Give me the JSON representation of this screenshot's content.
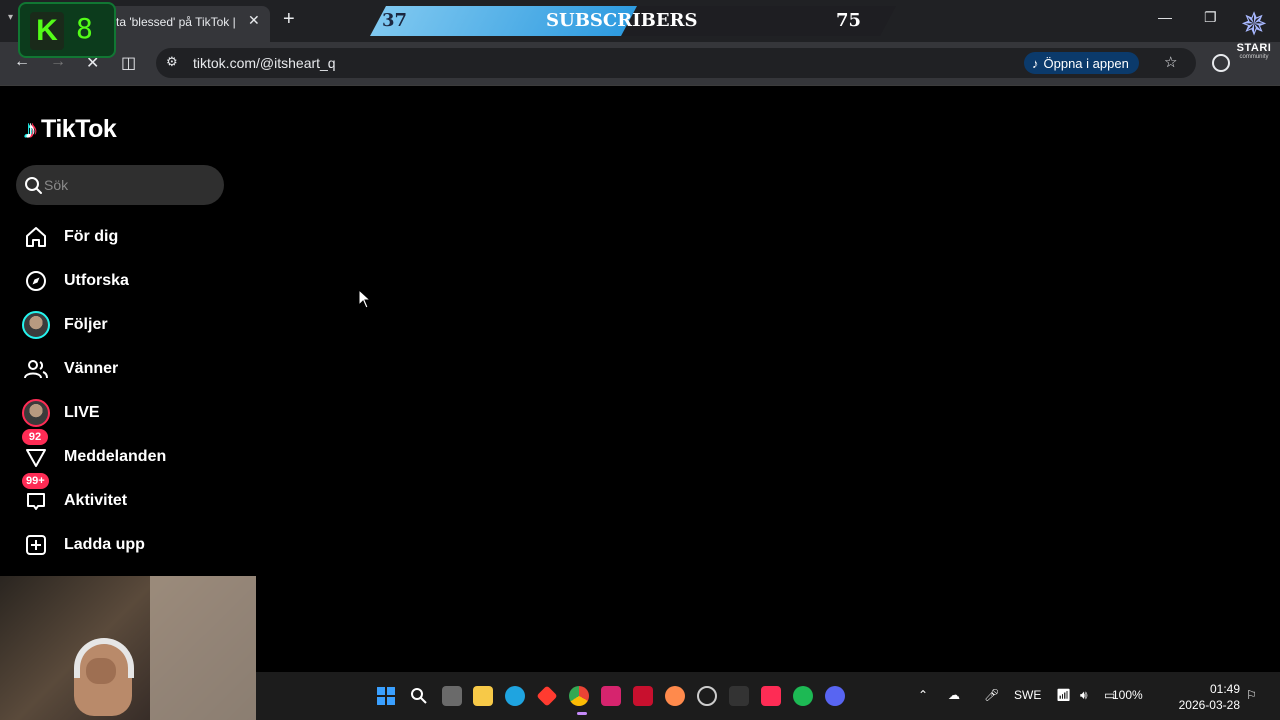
{
  "browser": {
    "tab_title": "ta 'blessed' på TikTok |",
    "url": "tiktok.com/@itsheart_q",
    "open_app_label": "Öppna i appen"
  },
  "overlay": {
    "kick_count": "8",
    "subscribers": {
      "current": "37",
      "label": "SUBSCRIBERS",
      "goal": "75",
      "progress_fraction": 0.493
    },
    "stari_label": "STARI",
    "stari_sub": "community"
  },
  "tiktok": {
    "logo_text": "TikTok",
    "search_placeholder": "Sök",
    "nav": [
      {
        "label": "För dig",
        "icon": "home-icon"
      },
      {
        "label": "Utforska",
        "icon": "compass-icon"
      },
      {
        "label": "Följer",
        "icon": "following-avatar-icon"
      },
      {
        "label": "Vänner",
        "icon": "friends-icon"
      },
      {
        "label": "LIVE",
        "icon": "live-avatar-icon"
      },
      {
        "label": "Meddelanden",
        "icon": "messages-icon",
        "badge": "92"
      },
      {
        "label": "Aktivitet",
        "icon": "activity-icon",
        "badge": "99+"
      },
      {
        "label": "Ladda upp",
        "icon": "upload-icon"
      }
    ]
  },
  "taskbar": {
    "language": "SWE",
    "battery": "100%",
    "time": "01:49",
    "date": "2026-03-28"
  },
  "colors": {
    "tiktok_red": "#fe2c55",
    "tiktok_cyan": "#25f4ee",
    "kick_green": "#53fc18",
    "open_app_bg": "#0b3a6b"
  }
}
